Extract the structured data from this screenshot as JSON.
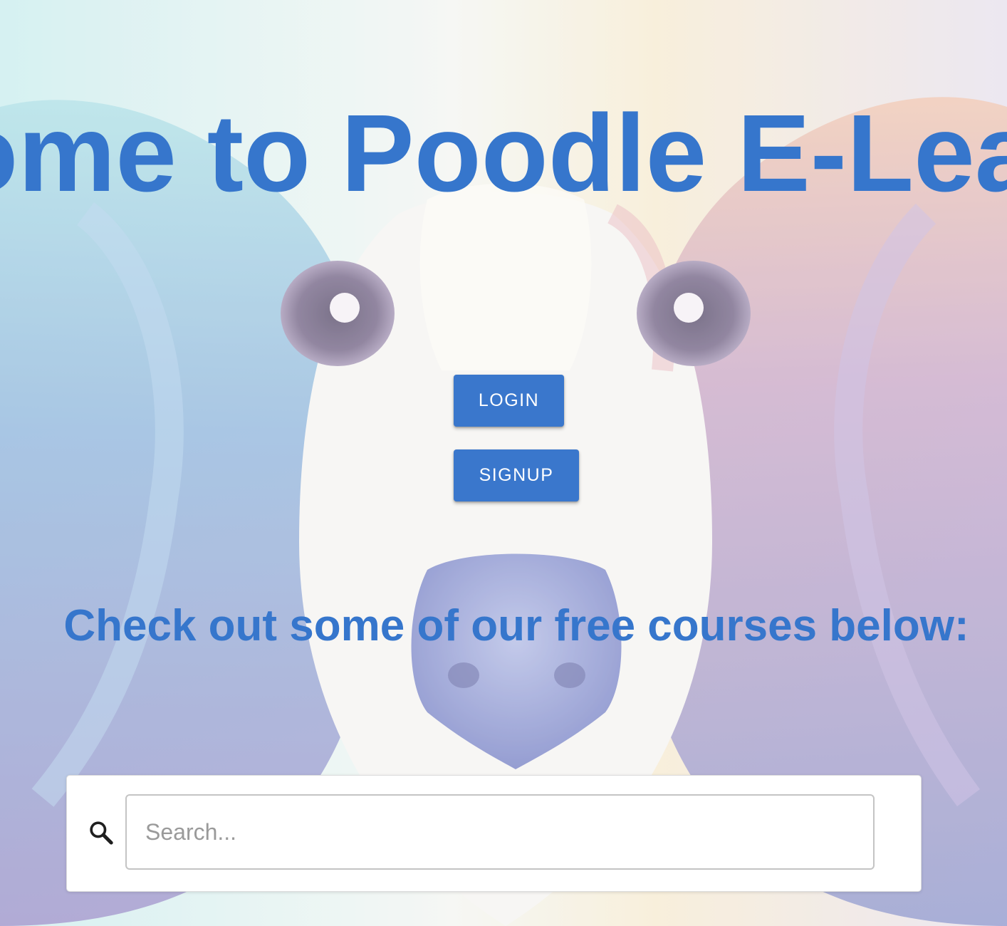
{
  "hero": {
    "title": "Welcome to Poodle E-Learning"
  },
  "auth": {
    "login_label": "LOGIN",
    "signup_label": "SIGNUP"
  },
  "courses": {
    "heading": "Check out some of our free courses below:"
  },
  "search": {
    "icon": "search-icon",
    "placeholder": "Search...",
    "value": ""
  },
  "colors": {
    "accent": "#3676cc",
    "button": "#3a77cc"
  }
}
